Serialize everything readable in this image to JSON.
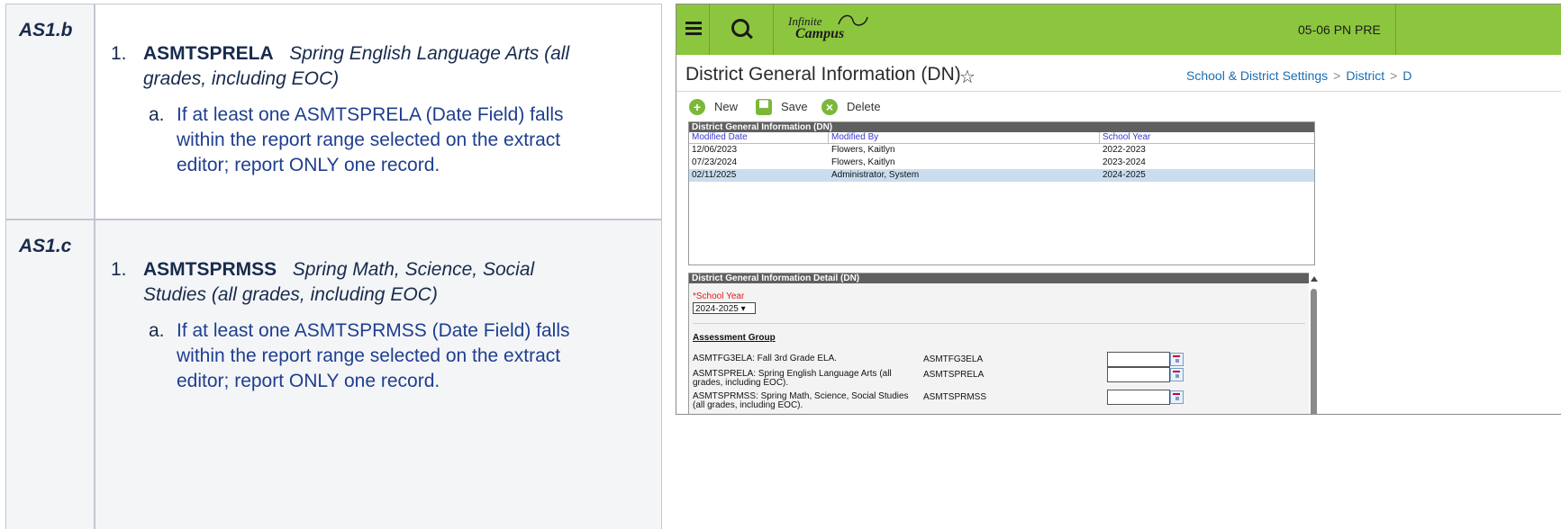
{
  "doc": {
    "rows": [
      {
        "key": "AS1.b",
        "item_num": "1.",
        "code": "ASMTSPRELA",
        "desc_line1": "Spring English Language Arts (all",
        "desc_line2": "grades, including EOC)",
        "sub_num": "a.",
        "sub_line1": "If at least one ASMTSPRELA (Date Field) falls",
        "sub_line2": "within the report range selected on the extract",
        "sub_line3": "editor; report ONLY one record."
      },
      {
        "key": "AS1.c",
        "item_num": "1.",
        "code": "ASMTSPRMSS",
        "desc_line1": "Spring Math, Science, Social",
        "desc_line2": "Studies (all grades, including EOC)",
        "sub_num": "a.",
        "sub_line1": "If at least one ASMTSPRMSS (Date Field) falls",
        "sub_line2": "within the report range selected on the extract",
        "sub_line3": "editor; report ONLY one record."
      }
    ]
  },
  "app": {
    "logo_line1": "Infinite",
    "logo_line2": "Campus",
    "school": "05-06 PN PRE",
    "page_title": "District General Information (DN)",
    "star": "☆",
    "breadcrumbs": [
      "School & District Settings",
      "District",
      "D"
    ],
    "toolbar": {
      "new": "New",
      "save": "Save",
      "delete": "Delete"
    },
    "list": {
      "title": "District General Information (DN)",
      "headers": [
        "Modified Date",
        "Modified By",
        "School Year"
      ],
      "rows": [
        [
          "12/06/2023",
          "Flowers, Kaitlyn",
          "2022-2023"
        ],
        [
          "07/23/2024",
          "Flowers, Kaitlyn",
          "2023-2024"
        ],
        [
          "02/11/2025",
          "Administrator, System",
          "2024-2025"
        ]
      ]
    },
    "detail": {
      "title": "District General Information Detail (DN)",
      "school_year_label": "*School Year",
      "school_year_value": "2024-2025 ▾",
      "group_title": "Assessment Group",
      "fields": [
        {
          "label": "ASMTFG3ELA: Fall 3rd Grade ELA.",
          "code": "ASMTFG3ELA"
        },
        {
          "label": "ASMTSPRELA: Spring English Language Arts (all grades, including EOC).",
          "code": "ASMTSPRELA"
        },
        {
          "label": "ASMTSPRMSS: Spring Math, Science, Social Studies (all grades, including EOC).",
          "code": "ASMTSPRMSS"
        }
      ]
    }
  }
}
